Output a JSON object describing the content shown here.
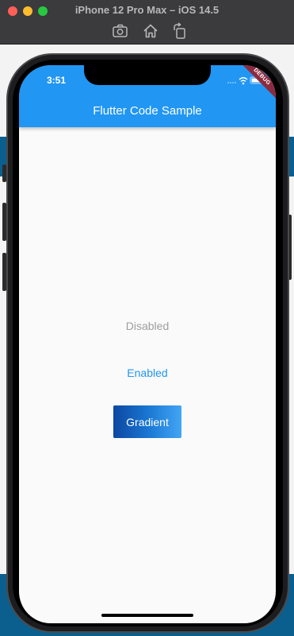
{
  "window": {
    "title": "iPhone 12 Pro Max – iOS 14.5",
    "toolbar": {
      "screenshot_icon": "camera-icon",
      "home_icon": "home-icon",
      "rotate_icon": "rotate-icon"
    }
  },
  "status_bar": {
    "time": "3:51",
    "icons": [
      "cellular-icon",
      "wifi-icon",
      "battery-icon"
    ]
  },
  "app": {
    "title": "Flutter Code Sample",
    "debug_banner": "DEBUG",
    "primary_color": "#2196f3"
  },
  "buttons": {
    "disabled_label": "Disabled",
    "enabled_label": "Enabled",
    "gradient_label": "Gradient"
  },
  "colors": {
    "gradient_start": "#0d47a1",
    "gradient_mid": "#1976d2",
    "gradient_end": "#42a5f5",
    "disabled_text": "#9e9e9e"
  }
}
